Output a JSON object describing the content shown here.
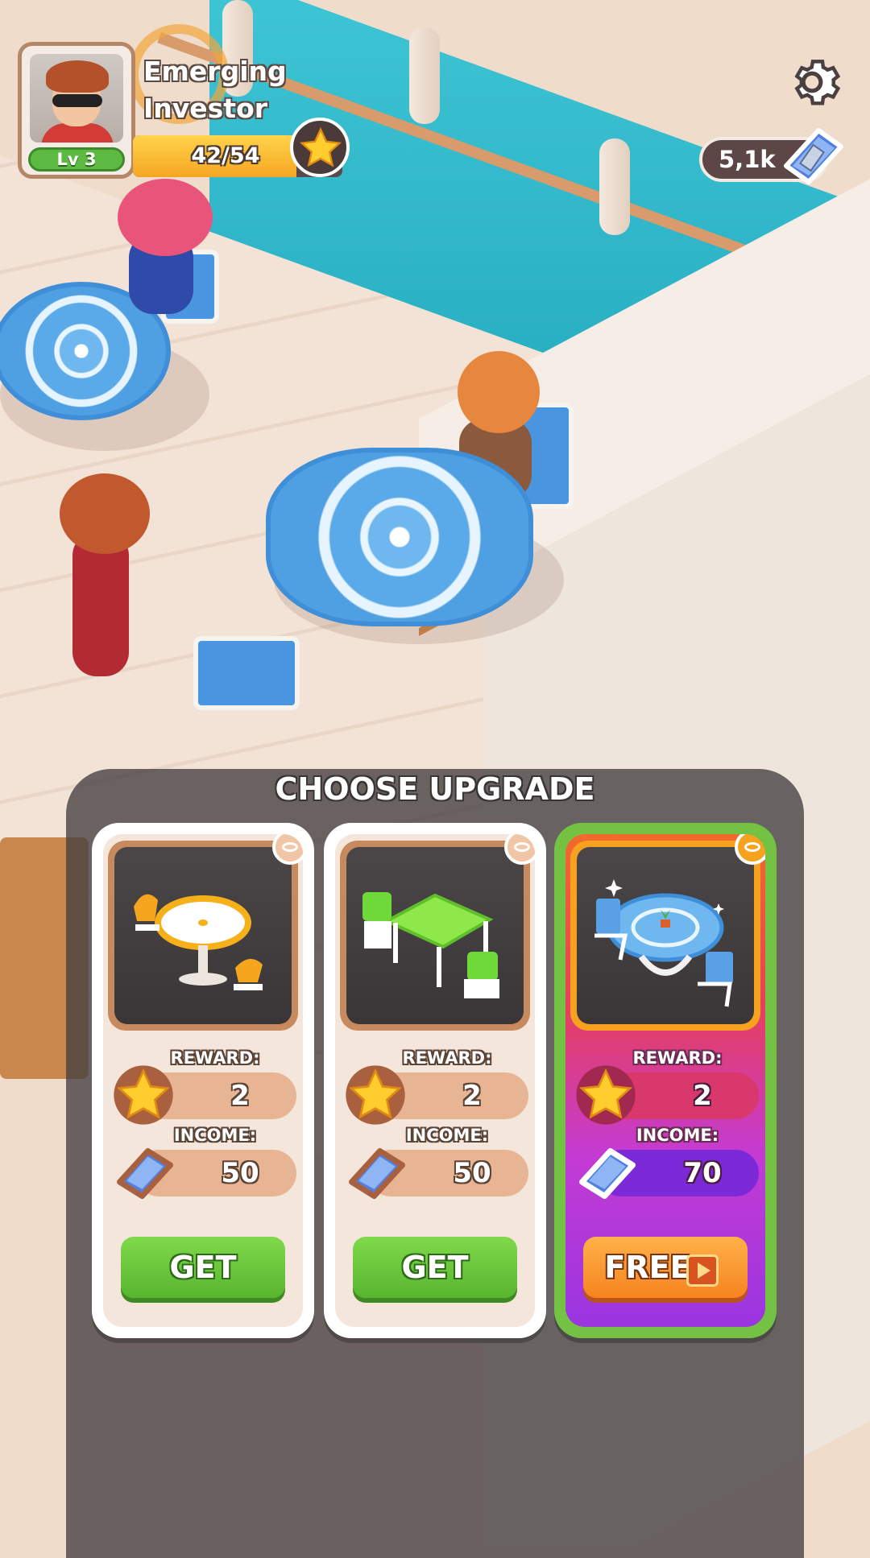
{
  "player": {
    "level_label": "Lv 3",
    "rank_title_line1": "Emerging",
    "rank_title_line2": "Investor",
    "xp_text": "42/54",
    "xp_progress": 0.78
  },
  "currency": {
    "cash_amount": "5,1k",
    "icon": "cash-stack-icon"
  },
  "settings": {
    "icon": "gear-icon"
  },
  "upgrade_panel": {
    "title": "CHOOSE UPGRADE",
    "cards": [
      {
        "item_icon": "white-round-table-set-icon",
        "reward_label": "REWARD:",
        "reward_value": "2",
        "income_label": "INCOME:",
        "income_value": "50",
        "button_label": "GET",
        "premium": false
      },
      {
        "item_icon": "green-square-table-set-icon",
        "reward_label": "REWARD:",
        "reward_value": "2",
        "income_label": "INCOME:",
        "income_value": "50",
        "button_label": "GET",
        "premium": false
      },
      {
        "item_icon": "blue-glass-table-set-icon",
        "reward_label": "REWARD:",
        "reward_value": "2",
        "income_label": "INCOME:",
        "income_value": "70",
        "button_label": "FREE",
        "button_icon": "video-play-icon",
        "premium": true
      }
    ]
  },
  "colors": {
    "get_button": "#6cc83c",
    "free_button": "#f6941f",
    "premium_border": "#74c244",
    "pool": "#2ab0c3"
  }
}
